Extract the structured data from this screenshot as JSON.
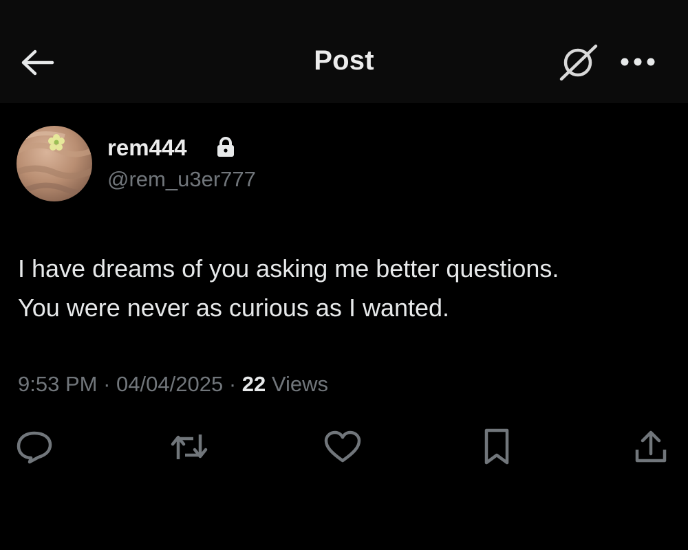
{
  "header": {
    "title": "Post",
    "back_icon": "arrow-left-icon",
    "grok_icon": "grok-icon",
    "more_icon": "more-dots-icon"
  },
  "author": {
    "display_name": "rem444",
    "handle": "@rem_u3er777",
    "protected_icon": "lock-icon"
  },
  "post": {
    "lines": [
      "I have dreams of you asking me better questions.",
      "You were never as curious as I wanted."
    ],
    "time": "9:53 PM",
    "date": "04/04/2025",
    "separator": "·",
    "views_count": "22",
    "views_label": "Views"
  },
  "actions": {
    "reply_icon": "reply-icon",
    "repost_icon": "repost-icon",
    "like_icon": "heart-icon",
    "bookmark_icon": "bookmark-icon",
    "share_icon": "share-icon"
  },
  "colors": {
    "background": "#000000",
    "header_bg": "#0b0b0b",
    "primary_text": "#e7e9ea",
    "secondary_text": "#71767b",
    "icon": "#71767b"
  }
}
